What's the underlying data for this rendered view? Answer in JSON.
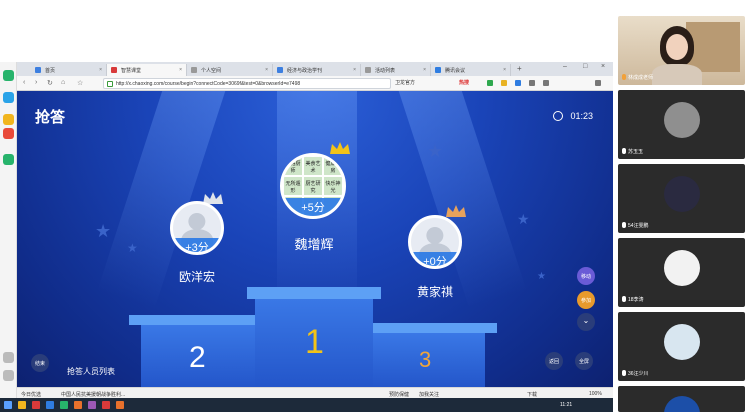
{
  "browser": {
    "tabs": [
      {
        "label": "首页",
        "color": "#3d7fe0"
      },
      {
        "label": "智慧课堂",
        "color": "#d83a3a"
      },
      {
        "label": "个人空间",
        "color": "#999999"
      },
      {
        "label": "经济与政治学刊",
        "color": "#3d7fe0"
      },
      {
        "label": "活动列表",
        "color": "#999999"
      },
      {
        "label": "腾讯会议",
        "color": "#2f7de1"
      }
    ],
    "url": "http://x.chaoxing.com/course/begin?connectCode=3069f&test=0&browserId=e7498",
    "search_label": "卫龙官方",
    "hot_label": "热搜"
  },
  "quiz": {
    "title": "抢答",
    "timer": "01:23",
    "first": {
      "name": "魏增辉",
      "score": "+5分",
      "place": "1"
    },
    "second": {
      "name": "欧洋宏",
      "score": "+3分",
      "place": "2"
    },
    "third": {
      "name": "黄家祺",
      "score": "+0分",
      "place": "3"
    },
    "first_avatar_text": [
      "合格厨师",
      "美食艺术",
      "健康厨房",
      "无所遁形",
      "厨艺研究",
      "快乐神光",
      "",
      "",
      ""
    ],
    "side_buttons": [
      "移动",
      "参加"
    ],
    "end_button": "结束",
    "list_link": "抢答人员列表",
    "back_button": "返回",
    "fullscreen_button": "全屏"
  },
  "statusbar": {
    "left": "今日优选",
    "news": "中国人民抗美援朝战争胜利...",
    "weather": "预防保健",
    "follow": "加我关注",
    "download": "下载",
    "zoom": "100%"
  },
  "taskbar": {
    "time": "11:21"
  },
  "participants": [
    {
      "name": "林成成老师",
      "kind": "video"
    },
    {
      "name": "苏玉玉",
      "kind": "avatar",
      "color": "#8f8f8f"
    },
    {
      "name": "54汪雯鹏",
      "kind": "avatar",
      "color": "#2a2a40"
    },
    {
      "name": "18李涛",
      "kind": "avatar",
      "color": "#f2f2f2"
    },
    {
      "name": "36汪少川",
      "kind": "avatar",
      "color": "#d8e6f0"
    }
  ],
  "colors": {
    "accent": "#2f7de1",
    "stage": "#1a44b8",
    "gold": "#f2c318"
  }
}
